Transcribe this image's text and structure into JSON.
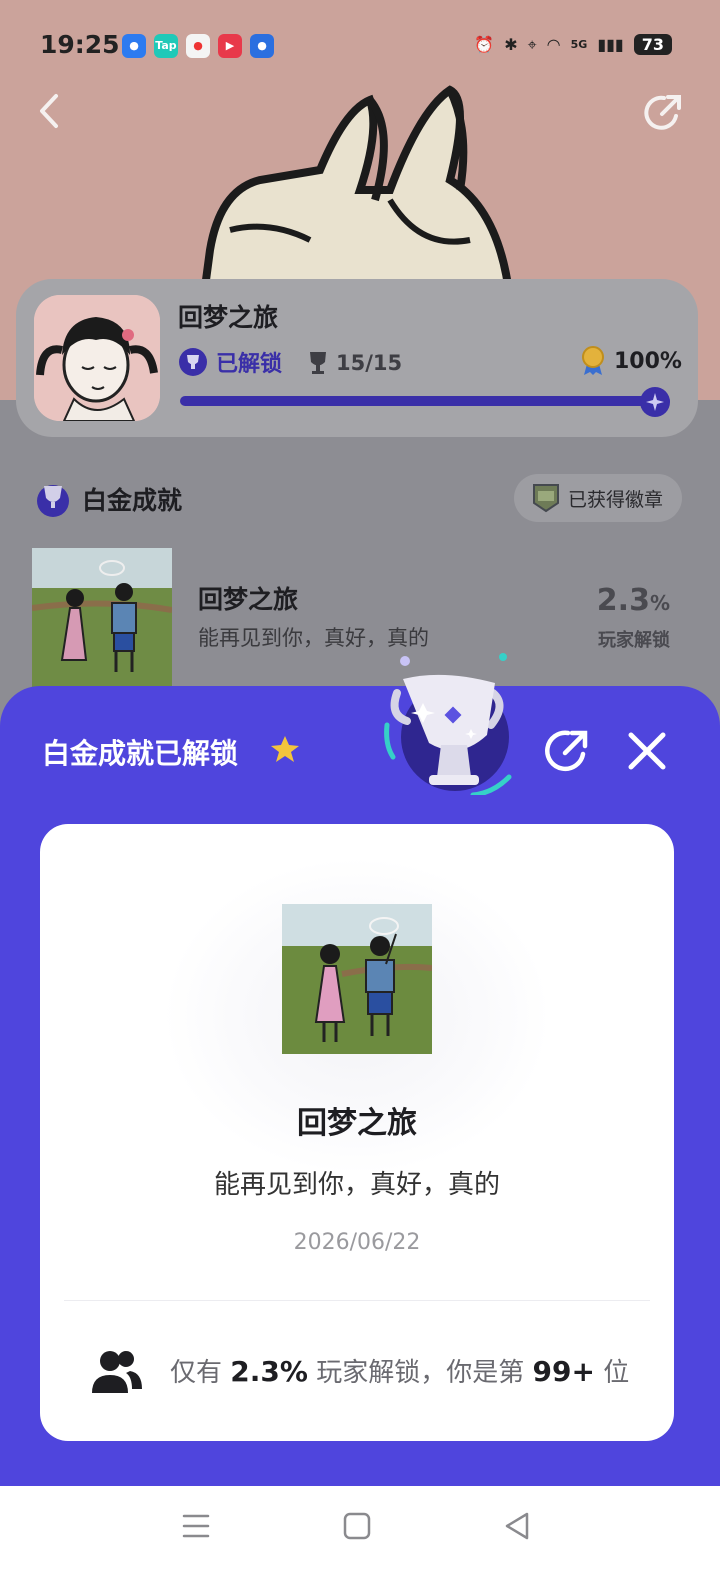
{
  "status_bar": {
    "time": "19:25",
    "network": "5G",
    "battery": "73"
  },
  "hero": {
    "header_text": "回梦之旅"
  },
  "game": {
    "title": "回梦之旅",
    "unlocked_label": "已解锁",
    "trophy_count": "15/15",
    "completion": "100%",
    "progress": 1.0
  },
  "section": {
    "title": "白金成就",
    "badge_chip_label": "已获得徽章"
  },
  "achievement_row": {
    "title": "回梦之旅",
    "description": "能再见到你，真好，真的",
    "rate_value": "2.3",
    "rate_unit": "%",
    "rate_label": "玩家解锁"
  },
  "sheet": {
    "title": "白金成就已解锁",
    "card": {
      "title": "回梦之旅",
      "description": "能再见到你，真好，真的",
      "date": "2026/06/22",
      "rank_prefix": "仅有",
      "rank_rate": "2.3%",
      "rank_middle": "玩家解锁，你是第",
      "rank_value": "99+",
      "rank_suffix": "位"
    }
  },
  "icons": {
    "back": "chevron-left-icon",
    "share": "share-icon",
    "close": "close-icon",
    "trophy": "trophy-icon",
    "players": "users-icon"
  },
  "colors": {
    "accent": "#4f45dd",
    "accent_dark": "#3a2fa8",
    "gold": "#f2c43c"
  }
}
